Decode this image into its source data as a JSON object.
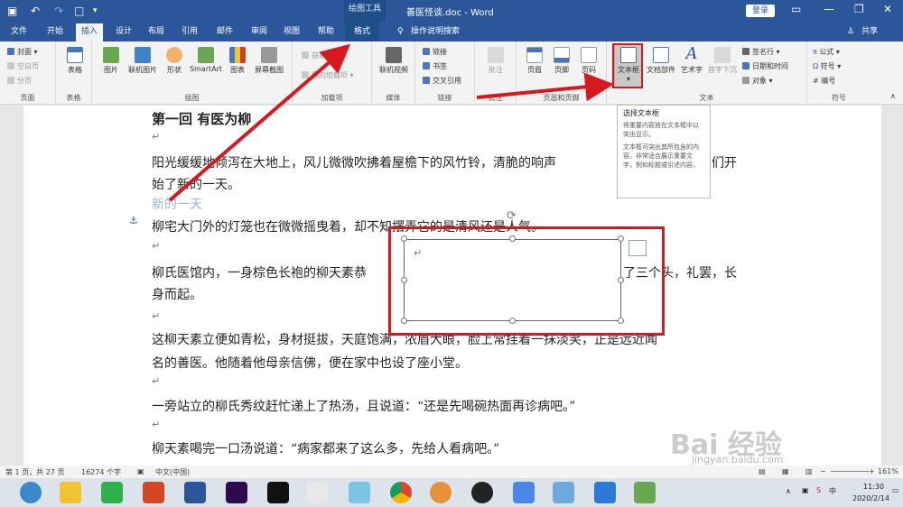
{
  "titlebar": {
    "tools_label": "绘图工具",
    "doc_title": "善医怪谈.doc - Word",
    "login": "登录"
  },
  "tabs": [
    "文件",
    "开始",
    "插入",
    "设计",
    "布局",
    "引用",
    "邮件",
    "审阅",
    "视图",
    "帮助",
    "格式"
  ],
  "tell_me": "操作说明搜索",
  "share": "共享",
  "groups": [
    "页面",
    "表格",
    "插图",
    "加载项",
    "媒体",
    "链接",
    "批注",
    "页眉和页脚",
    "文本",
    "符号"
  ],
  "pages": {
    "cover": "封面",
    "blank": "空白页",
    "break": "分页"
  },
  "table": "表格",
  "illus": [
    "图片",
    "联机图片",
    "形状",
    "SmartArt",
    "图表",
    "屏幕截图"
  ],
  "addins": {
    "get": "获取加载项",
    "my": "我的加载项"
  },
  "media": "联机视频",
  "links": [
    "链接",
    "书签",
    "交叉引用"
  ],
  "comment": "批注",
  "hf": [
    "页眉",
    "页脚",
    "页码"
  ],
  "text": {
    "textbox": "文本框",
    "quickparts": "文档部件",
    "wordart": "艺术字",
    "dropcap": "首字下沉",
    "sig": "签名行",
    "date": "日期和时间",
    "obj": "对象"
  },
  "symbols": [
    "公式",
    "符号",
    "编号"
  ],
  "tooltip": {
    "title": "选择文本框",
    "p1": "将重要内容放在文本框中以突出显示。",
    "p2": "文本框可突出其所包含的内容，非常适合展示重要文字，例如标题或引述内容。"
  },
  "doc": {
    "heading": "第一回 有医为柳",
    "p1a": "阳光缓缓地倾泻在大地上，风儿微微吹拂着屋檐下的风竹铃，清脆的响声",
    "p1b": "们开",
    "p1c": "始了新的一天。",
    "sub": "新的一天",
    "p2": "柳宅大门外的灯笼也在微微摇曳着，却不知摆弄它的是清风还是人气。",
    "p3a": "柳氏医馆内，一身棕色长袍的柳天素恭",
    "p3b": "了三个头，礼罢，长",
    "p3c": "身而起。",
    "p4a": "这柳天素立便如青松，身材挺拔，天庭饱满，浓眉大眼，脸上常挂着一抹淡笑，正是远近闻",
    "p4b": "名的善医。他随着他母亲信佛，便在家中也设了座小堂。",
    "p5": "一旁站立的柳氏秀纹赶忙递上了热汤，且说道：“还是先喝碗热面再诊病吧。”",
    "p6": "柳天素喝完一口汤说道：“病家都来了这么多，先给人看病吧。”",
    "para": "↵"
  },
  "status": {
    "page": "第 1 页，共 27 页",
    "words": "16274 个字",
    "lang": "中文(中国)",
    "zoom": "161%"
  },
  "clock": {
    "time": "11:30",
    "date": "2020/2/14"
  },
  "watermark": {
    "text": "Bai 经验",
    "url": "jingyan.baidu.com"
  }
}
